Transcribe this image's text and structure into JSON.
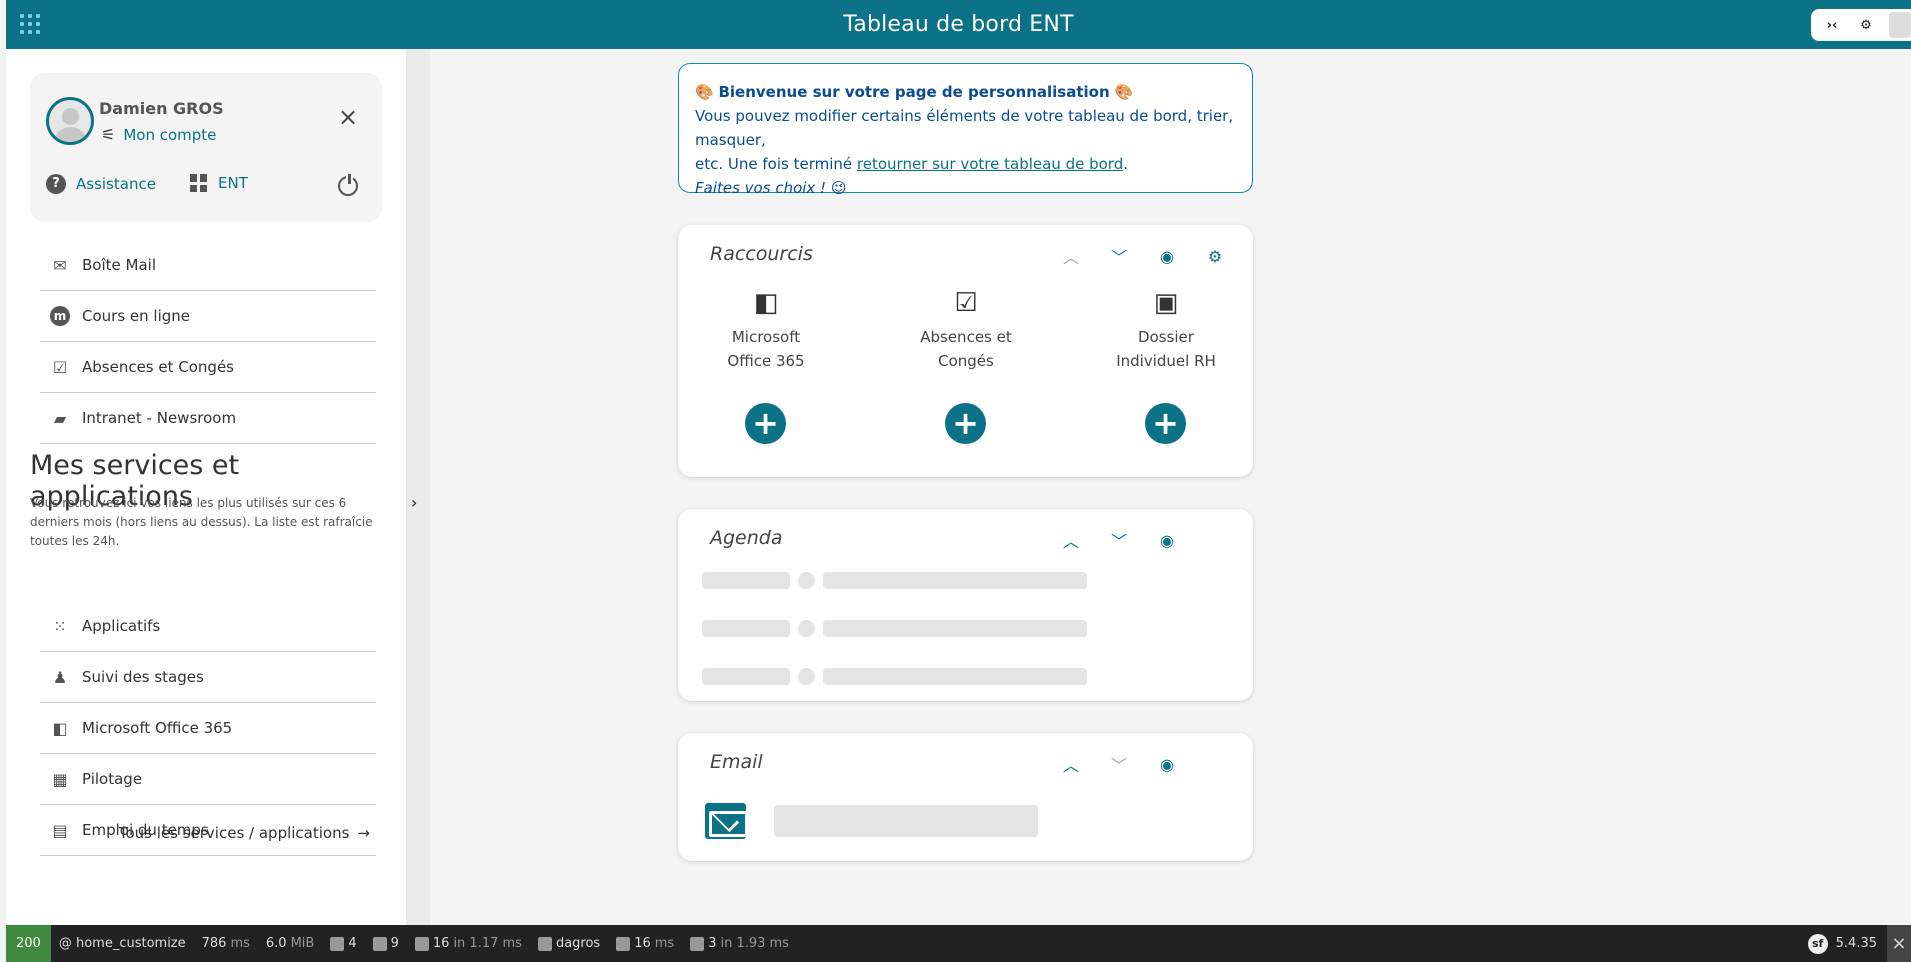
{
  "header": {
    "title": "Tableau de bord ENT"
  },
  "profile": {
    "name": "Damien GROS",
    "account_label": "Mon compte",
    "assistance_label": "Assistance",
    "ent_label": "ENT"
  },
  "quick_links": [
    {
      "label": "Boîte Mail",
      "icon": "mail-icon"
    },
    {
      "label": "Cours en ligne",
      "icon": "moodle-icon"
    },
    {
      "label": "Absences et Congés",
      "icon": "calendar-check-icon"
    },
    {
      "label": "Intranet - Newsroom",
      "icon": "folder-lock-icon"
    }
  ],
  "services": {
    "title": "Mes services et applications",
    "description": "Vous retrouvez ici vos liens les plus utilisés sur ces 6 derniers mois (hors liens au dessus). La liste est rafraîcie toutes les 24h.",
    "items": [
      {
        "label": "Applicatifs",
        "icon": "apps-grid-icon"
      },
      {
        "label": "Suivi des stages",
        "icon": "person-desk-icon"
      },
      {
        "label": "Microsoft Office 365",
        "icon": "office-icon"
      },
      {
        "label": "Pilotage",
        "icon": "calculator-icon"
      },
      {
        "label": "Emploi du temps",
        "icon": "calendar-icon"
      }
    ],
    "all_link": "Tous les services / applications"
  },
  "welcome": {
    "heading": "Bienvenue sur votre page de personnalisation",
    "line1": "Vous pouvez modifier certains éléments de votre tableau de bord, trier, masquer,",
    "line2_prefix": "etc. Une fois terminé",
    "line2_link": "retourner sur votre tableau de bord",
    "line2_suffix": ".",
    "line3": "Faites vos choix !"
  },
  "raccourcis": {
    "title": "Raccourcis",
    "items": [
      {
        "label_1": "Microsoft",
        "label_2": "Office 365",
        "icon": "office-icon"
      },
      {
        "label_1": "Absences et",
        "label_2": "Congés",
        "icon": "calendar-check-icon"
      },
      {
        "label_1": "Dossier",
        "label_2": "Individuel RH",
        "icon": "id-badge-icon"
      }
    ]
  },
  "agenda": {
    "title": "Agenda"
  },
  "email": {
    "title": "Email"
  },
  "debug_bar": {
    "status": "200",
    "route": "@ home_customize",
    "time_value": "786",
    "time_unit": "ms",
    "memory_value": "6.0",
    "memory_unit": "MiB",
    "events": "4",
    "logs": "9",
    "cache": "16",
    "cache_in": "in 1.17 ms",
    "user": "dagros",
    "twig_value": "16",
    "twig_unit": "ms",
    "db": "3",
    "db_in": "in 1.93 ms",
    "version": "5.4.35"
  },
  "colors": {
    "accent": "#0b7287",
    "debug_status": "#3f8a3f"
  }
}
